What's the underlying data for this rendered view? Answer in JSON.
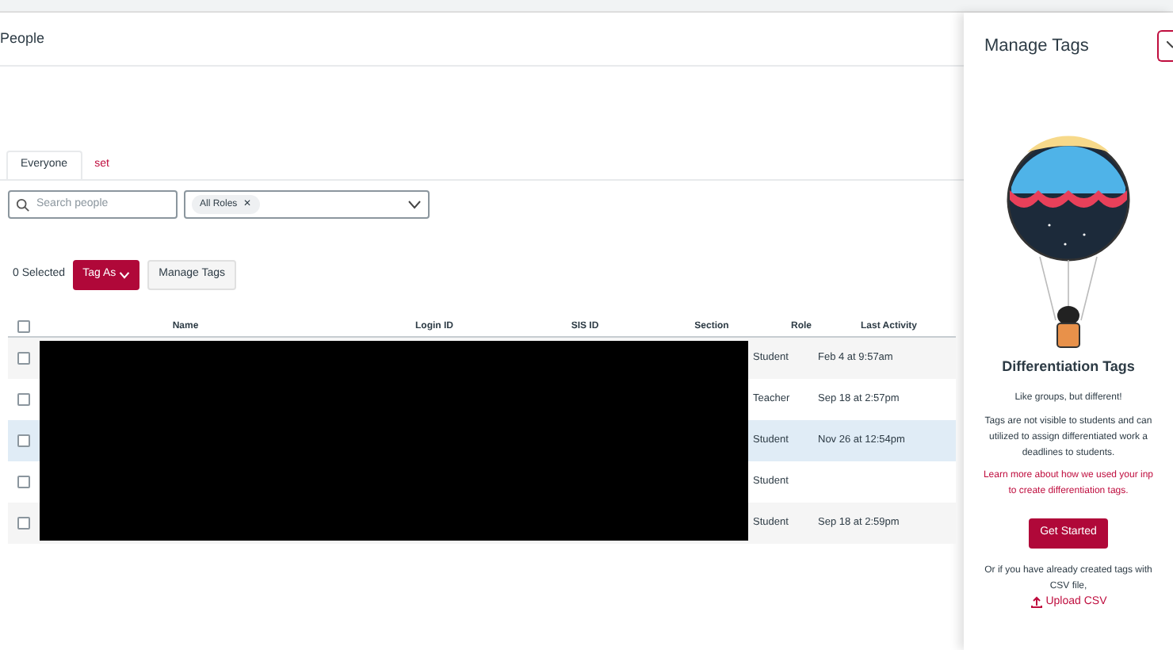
{
  "page": {
    "title": "People"
  },
  "tabs": [
    {
      "label": "Everyone",
      "selected": true
    },
    {
      "label": "set",
      "selected": false
    }
  ],
  "search": {
    "placeholder": "Search people"
  },
  "role_filter": {
    "chip": "All Roles",
    "chip_remove": "✕"
  },
  "toolbar": {
    "selected_count": "0 Selected",
    "tag_as": "Tag As",
    "manage_tags": "Manage Tags"
  },
  "table": {
    "select_all_checked": false,
    "columns": [
      "Name",
      "Login ID",
      "SIS ID",
      "Section",
      "Role",
      "Last Activity"
    ],
    "rows": [
      {
        "checked": false,
        "highlighted": false,
        "role": "Student",
        "last_activity": "Feb 4 at 9:57am"
      },
      {
        "checked": false,
        "highlighted": false,
        "role": "Teacher",
        "last_activity": "Sep 18 at 2:57pm"
      },
      {
        "checked": false,
        "highlighted": true,
        "role": "Student",
        "last_activity": "Nov 26 at 12:54pm"
      },
      {
        "checked": false,
        "highlighted": false,
        "role": "Student"
      },
      {
        "checked": false,
        "highlighted": false,
        "role": "Student",
        "last_activity": "Sep 18 at 2:59pm"
      }
    ]
  },
  "panel": {
    "title": "Manage Tags",
    "heading": "Differentiation Tags",
    "tagline": "Like groups, but different!",
    "description_lines": [
      "Tags are not visible to students and can",
      "utilized to assign differentiated work a",
      "deadlines to students."
    ],
    "link_lines": [
      "Learn more about how we used your inp",
      "to create differentiation tags."
    ],
    "button": "Get Started",
    "csv_lines": [
      "Or if you have already created tags with",
      "CSV file,"
    ],
    "upload": "Upload CSV"
  }
}
